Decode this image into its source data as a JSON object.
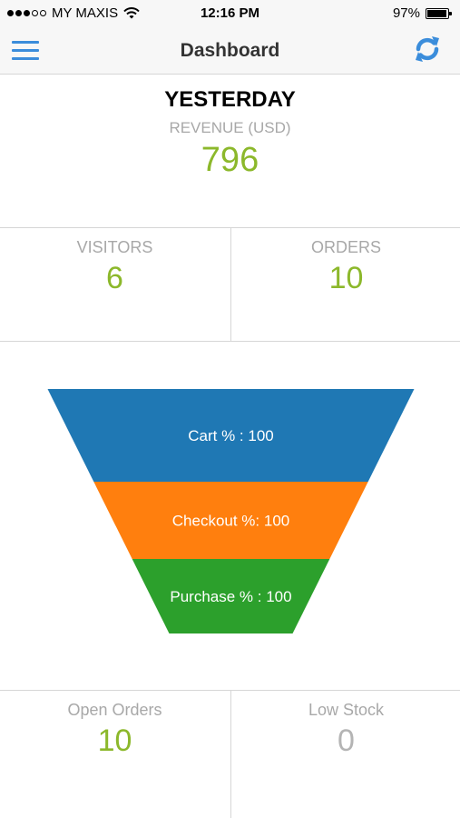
{
  "status": {
    "carrier": "MY MAXIS",
    "time": "12:16 PM",
    "battery": "97%",
    "battery_level": 0.97,
    "signal_bars": 3,
    "signal_total": 5
  },
  "nav": {
    "title": "Dashboard",
    "menu_icon": "hamburger-menu-icon",
    "refresh_icon": "refresh-icon",
    "accent": "#3b8ddb"
  },
  "yesterday": {
    "title": "YESTERDAY",
    "subtitle": "REVENUE (USD)",
    "value": "796"
  },
  "stats": {
    "visitors": {
      "label": "VISITORS",
      "value": "6"
    },
    "orders": {
      "label": "ORDERS",
      "value": "10"
    },
    "open_orders": {
      "label": "Open Orders",
      "value": "10"
    },
    "low_stock": {
      "label": "Low Stock",
      "value": "0"
    }
  },
  "colors": {
    "value_green": "#8cb82b",
    "label_gray": "#a8a8a8"
  },
  "chart_data": {
    "type": "funnel",
    "stages": [
      {
        "label": "Cart % : 100",
        "value": 100,
        "color": "#1f78b4"
      },
      {
        "label": "Checkout %: 100",
        "value": 100,
        "color": "#ff7f0e"
      },
      {
        "label": "Purchase % : 100",
        "value": 100,
        "color": "#2ca02c"
      }
    ]
  }
}
